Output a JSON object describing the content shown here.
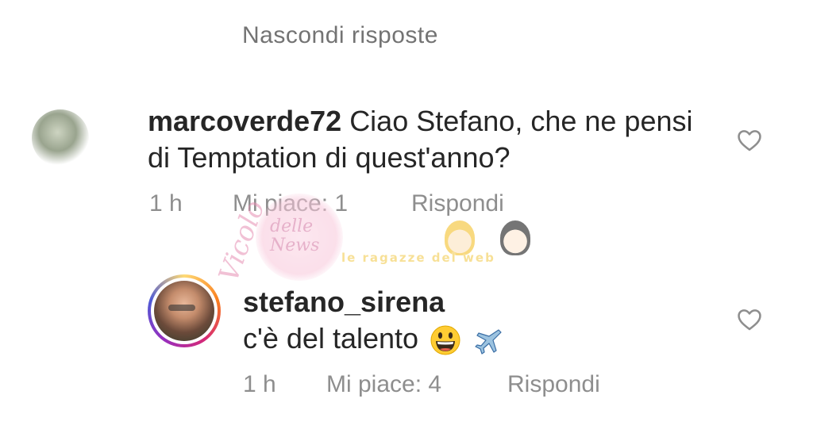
{
  "hide_replies_label": "Nascondi risposte",
  "comments": [
    {
      "username": "marcoverde72",
      "text": "Ciao Stefano, che ne pensi di  Temptation di quest'anno?",
      "time": "1 h",
      "likes": "Mi piace: 1",
      "reply": "Rispondi",
      "avatar_story_ring": false
    },
    {
      "username": "stefano_sirena",
      "text": "c'è del talento",
      "time": "1 h",
      "likes": "Mi piace: 4",
      "reply": "Rispondi",
      "avatar_story_ring": true,
      "emojis": [
        "grinning-face-emoji",
        "airplane-emoji"
      ]
    }
  ],
  "watermarks": {
    "vicolo_line1": "Vicolo",
    "vicolo_line2": "delle",
    "vicolo_line3": "News",
    "ragazze": "le ragazze del web"
  },
  "colors": {
    "text": "#262626",
    "meta": "#8e8e8e",
    "hide_replies": "#737373"
  }
}
